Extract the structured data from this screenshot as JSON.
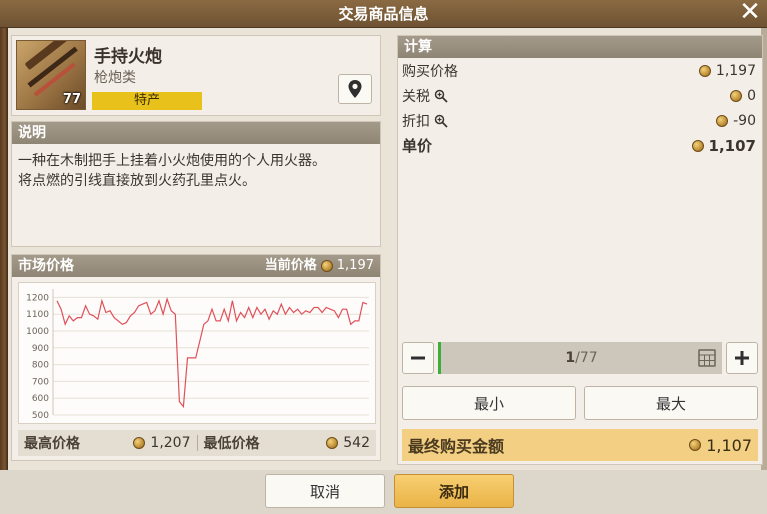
{
  "window": {
    "title": "交易商品信息",
    "close_glyph": "✕"
  },
  "item": {
    "name": "手持火炮",
    "category": "枪炮类",
    "count": "77",
    "tag": "特产"
  },
  "description": {
    "heading": "说明",
    "text_line1": "一种在木制把手上挂着小火炮使用的个人用火器。",
    "text_line2": "将点燃的引线直接放到火药孔里点火。"
  },
  "market": {
    "heading": "市场价格",
    "current_label": "当前价格",
    "current_value": "1,197",
    "high_label": "最高价格",
    "high_value": "1,207",
    "low_label": "最低价格",
    "low_value": "542"
  },
  "chart_data": {
    "type": "line",
    "title": "",
    "xlabel": "",
    "ylabel": "",
    "ylim": [
      500,
      1250
    ],
    "yticks": [
      1200,
      1100,
      1000,
      900,
      800,
      700,
      600,
      500
    ],
    "grid": true,
    "series": [
      {
        "color": "#e0505a",
        "values": [
          1180,
          1130,
          1040,
          1090,
          1060,
          1080,
          1080,
          1150,
          1100,
          1090,
          1070,
          1180,
          1110,
          1120,
          1080,
          1060,
          1040,
          1050,
          1090,
          1110,
          1150,
          1160,
          1170,
          1100,
          1120,
          1180,
          1100,
          1190,
          1120,
          1100,
          580,
          550,
          840,
          840,
          840,
          940,
          1040,
          1060,
          1130,
          1060,
          1060,
          1130,
          1060,
          1180,
          1060,
          1110,
          1080,
          1140,
          1080,
          1140,
          1100,
          1130,
          1070,
          1120,
          1100,
          1160,
          1100,
          1140,
          1110,
          1130,
          1100,
          1120,
          1110,
          1140,
          1140,
          1110,
          1140,
          1130,
          1120,
          1080,
          1130,
          1130,
          1040,
          1060,
          1060,
          1170,
          1160
        ]
      }
    ]
  },
  "calc": {
    "heading": "计算",
    "buy_price_label": "购买价格",
    "buy_price_value": "1,197",
    "tax_label": "关税",
    "tax_value": "0",
    "discount_label": "折扣",
    "discount_value": "-90",
    "unit_label": "单价",
    "unit_value": "1,107",
    "qty_current": "1",
    "qty_max": "/77",
    "min_label": "最小",
    "max_label": "最大",
    "total_label": "最终购买金额",
    "total_value": "1,107"
  },
  "footer": {
    "cancel_label": "取消",
    "add_label": "添加"
  },
  "icons": {
    "coin": "coin-icon",
    "magnifier": "magnifier-icon",
    "location": "map-pin-icon",
    "calculator": "calculator-icon"
  }
}
